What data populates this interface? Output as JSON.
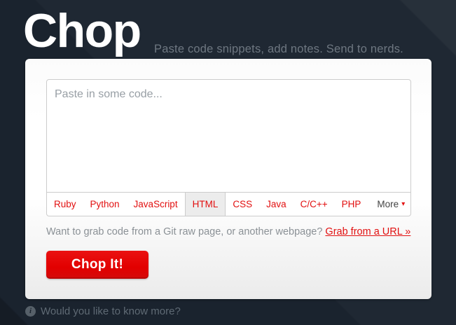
{
  "header": {
    "logo": "Chop",
    "tagline": "Paste code snippets, add notes. Send to nerds."
  },
  "editor": {
    "placeholder": "Paste in some code...",
    "languages": [
      {
        "label": "Ruby",
        "selected": false
      },
      {
        "label": "Python",
        "selected": false
      },
      {
        "label": "JavaScript",
        "selected": false
      },
      {
        "label": "HTML",
        "selected": true
      },
      {
        "label": "CSS",
        "selected": false
      },
      {
        "label": "Java",
        "selected": false
      },
      {
        "label": "C/C++",
        "selected": false
      },
      {
        "label": "PHP",
        "selected": false
      }
    ],
    "more": {
      "label": "More",
      "caret": "▾"
    }
  },
  "url_row": {
    "prompt": "Want to grab code from a Git raw page, or another webpage?",
    "link_label": "Grab from a URL »"
  },
  "submit_button": {
    "label": "Chop It!"
  },
  "footer": {
    "icon_glyph": "i",
    "text": "Would you like to know more?"
  },
  "colors": {
    "background": "#1a232e",
    "accent_red": "#e21010",
    "button_red": "#e20000",
    "card_white": "#ffffff",
    "border_gray": "#cccccc",
    "selected_tab_bg": "#ececec"
  }
}
